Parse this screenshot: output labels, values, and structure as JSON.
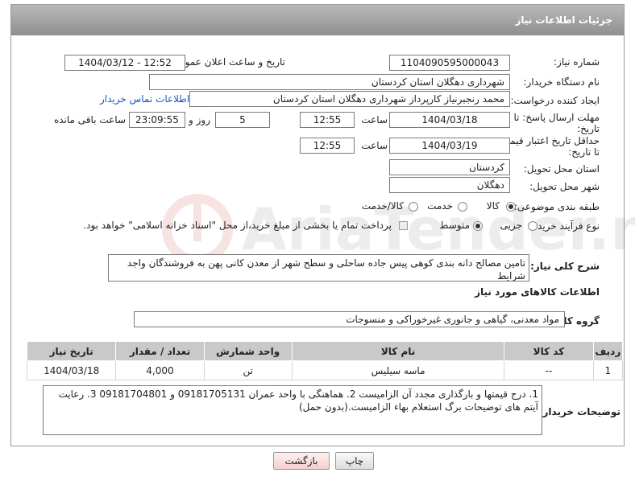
{
  "header": {
    "title": "جزئیات اطلاعات نیاز"
  },
  "fields": {
    "need_number_label": "شماره نیاز:",
    "need_number": "1104090595000043",
    "announce_label": "تاریخ و ساعت اعلان عمومی:",
    "announce_value": "1404/03/12 - 12:52",
    "buyer_org_label": "نام دستگاه خریدار:",
    "buyer_org": "شهرداری دهگلان استان کردستان",
    "requester_label": "ایجاد کننده درخواست:",
    "requester": "محمد رنجبرنیاز کارپرداز شهرداری دهگلان استان کردستان",
    "contact_link": "اطلاعات تماس خریدار",
    "deadline_label_1": "مهلت ارسال پاسخ: تا",
    "deadline_label_2": "تاریخ:",
    "deadline_date": "1404/03/18",
    "time_label": "ساعت",
    "deadline_time": "12:55",
    "days_value": "5",
    "days_label": "روز و",
    "remaining_value": "23:09:55",
    "remaining_label": "ساعت باقی مانده",
    "validity_label_1": "حداقل تاریخ اعتبار قیمت:",
    "validity_label_2": "تا تاریخ:",
    "validity_date": "1404/03/19",
    "validity_time": "12:55",
    "province_label": "استان محل تحویل:",
    "province": "کردستان",
    "city_label": "شهر محل تحویل:",
    "city": "دهگلان",
    "category_label": "طبقه بندی موضوعی:",
    "category_options": [
      "کالا",
      "خدمت",
      "کالا/خدمت"
    ],
    "process_label": "نوع فرآیند خرید :",
    "process_options": [
      "جزیی",
      "متوسط"
    ],
    "payment_note": "پرداخت تمام یا بخشی از مبلغ خرید،از محل \"اسناد خزانه اسلامی\" خواهد بود.",
    "description_label": "شرح کلی نیاز:",
    "description": "تامین مصالح دانه بندی کوهی پیس جاده ساحلی و سطح شهر از معدن کانی پهن به فروشندگان واجد شرایط",
    "goods_info_title": "اطلاعات کالاهای مورد نیاز",
    "goods_group_label": "گروه کالا:",
    "goods_group": "مواد معدنی، گیاهی و جانوری غیرخوراکی و منسوجات"
  },
  "table": {
    "headers": [
      "ردیف",
      "کد کالا",
      "نام کالا",
      "واحد شمارش",
      "تعداد / مقدار",
      "تاریخ نیاز"
    ],
    "rows": [
      [
        "1",
        "--",
        "ماسه سیلیس",
        "تن",
        "4,000",
        "1404/03/18"
      ]
    ]
  },
  "buyer_notes_label": "توضیحات خریدار:",
  "buyer_notes": "1. درج قیمتها و بارگذاری مجدد آن الزامیست 2. هماهنگی با واحد عمران 09181705131 و 09181704801 3. رعایت آیتم های توضیحات برگ استعلام بهاء الزامیست.(بدون حمل)",
  "buttons": {
    "back": "بازگشت",
    "print": "چاپ"
  },
  "watermark": "AriaTender.neT",
  "colors": {
    "header_bg": "#a3a3a3",
    "link": "#1a56c4",
    "back_button_bg": "#fde2e2"
  }
}
